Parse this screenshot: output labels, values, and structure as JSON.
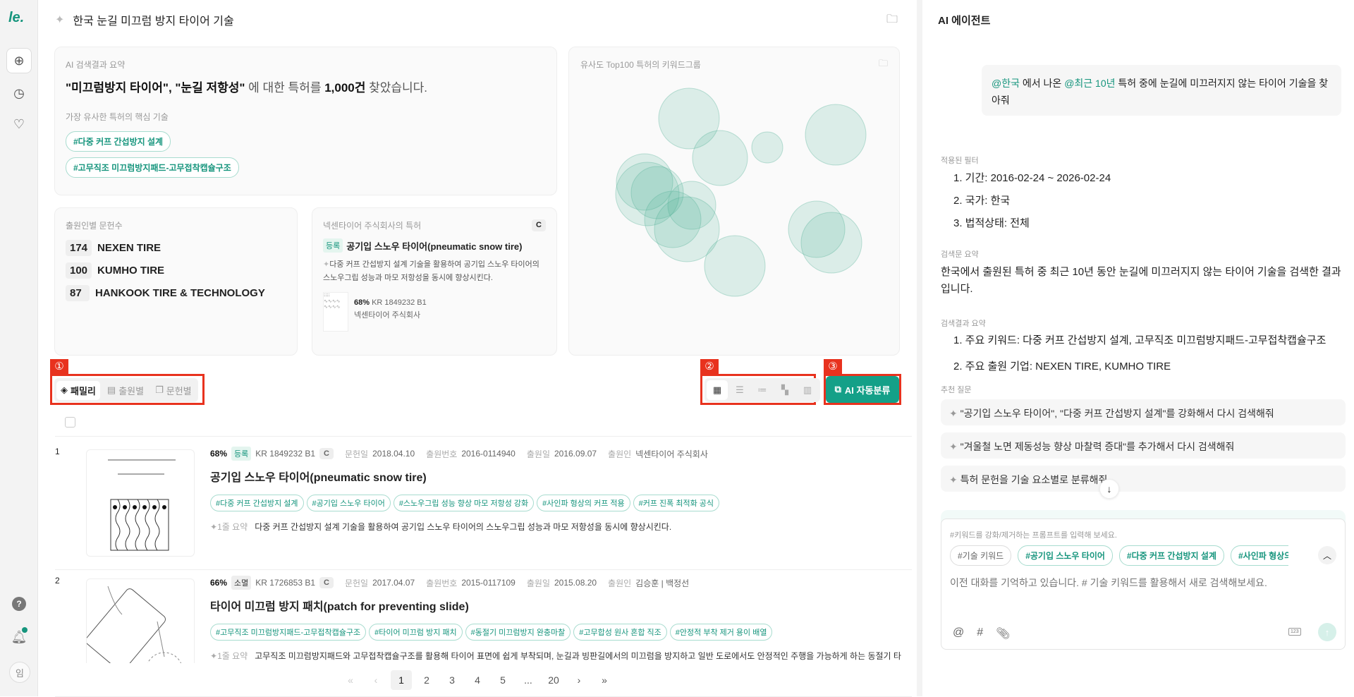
{
  "sidebar": {
    "logo": "le.",
    "avatar": "임",
    "items": [
      "new-search",
      "history",
      "ideas",
      "help",
      "notifications"
    ]
  },
  "header": {
    "title": "한국 눈길 미끄럼 방지 타이어 기술"
  },
  "summary": {
    "label": "AI 검색결과 요약",
    "q1": "\"미끄럼방지 타이어\", \"눈길 저항성\"",
    "mid": " 에 대한 특허를 ",
    "count": "1,000건",
    "end": " 찾았습니다.",
    "core_label": "가장 유사한 특허의 핵심 기술",
    "core_tags": [
      "#다중 커프 간섭방지 설계",
      "#고무직조 미끄럼방지패드-고무접착캡슐구조"
    ]
  },
  "keyword_group": {
    "label": "유사도 Top100 특허의 키워드그룹"
  },
  "applicants": {
    "label": "출원인별 문헌수",
    "items": [
      {
        "count": "174",
        "name": "NEXEN TIRE"
      },
      {
        "count": "100",
        "name": "KUMHO TIRE"
      },
      {
        "count": "87",
        "name": "HANKOOK TIRE & TECHNOLOGY"
      }
    ]
  },
  "featured": {
    "label": "넥센타이어 주식회사의 특허",
    "grade": "C",
    "status": "등록",
    "title": "공기입 스노우 타이어(pneumatic snow tire)",
    "desc": "다중 커프 간섭방지 설계 기술을 활용하여 공기입 스노우 타이어의 스노우그립 성능과 마모 저항성을 동시에 향상시킨다.",
    "score": "68%",
    "number": "KR 1849232 B1",
    "owner": "넥센타이어 주식회사"
  },
  "toolbar": {
    "tabs": [
      "패밀리",
      "출원별",
      "문헌별"
    ],
    "ai_button": "AI 자동분류",
    "markers": [
      "①",
      "②",
      "③"
    ]
  },
  "results": [
    {
      "rank": "1",
      "score": "68%",
      "status": "등록",
      "number": "KR 1849232 B1",
      "grade": "C",
      "pub_label": "문헌일",
      "pub": "2018.04.10",
      "appno_label": "출원번호",
      "appno": "2016-0114940",
      "appdate_label": "출원일",
      "appdate": "2016.09.07",
      "applicant_label": "출원인",
      "applicant": "넥센타이어 주식회사",
      "title": "공기입 스노우 타이어(pneumatic snow tire)",
      "tags": [
        "#다중 커프 간섭방지 설계",
        "#공기입 스노우 타이어",
        "#스노우그립 성능 향상 마모 저항성 강화",
        "#사인파 형상의 커프 적용",
        "#커프 진폭 최적화 공식"
      ],
      "summary_label": "1줄 요약",
      "summary": "다중 커프 간섭방지 설계 기술을 활용하여 공기입 스노우 타이어의 스노우그립 성능과 마모 저항성을 동시에 향상시킨다."
    },
    {
      "rank": "2",
      "score": "66%",
      "status": "소멸",
      "number": "KR 1726853 B1",
      "grade": "C",
      "pub_label": "문헌일",
      "pub": "2017.04.07",
      "appno_label": "출원번호",
      "appno": "2015-0117109",
      "appdate_label": "출원일",
      "appdate": "2015.08.20",
      "applicant_label": "출원인",
      "applicant": "김승훈 | 백정선",
      "title": "타이어 미끄럼 방지 패치(patch for preventing slide)",
      "tags": [
        "#고무직조 미끄럼방지패드-고무접착캡슐구조",
        "#타이어 미끄럼 방지 패치",
        "#동절기 미끄럼방지 완충마찰",
        "#고무합성 원사 혼합 직조",
        "#안정적 부착 제거 용이 배열"
      ],
      "summary_label": "1줄 요약",
      "summary": "고무직조 미끄럼방지패드와 고무접착캡슐구조를 활용해 타이어 표면에 쉽게 부착되며, 눈길과 빙판길에서의 미끄럼을 방지하고 일반 도로에서도 안정적인 주행을 가능하게 하는 동절기 타이"
    }
  ],
  "pagination": {
    "pages": [
      "1",
      "2",
      "3",
      "4",
      "5",
      "...",
      "20"
    ],
    "current": "1",
    "first": "«",
    "prev": "‹",
    "next": "›",
    "last": "»"
  },
  "agent": {
    "title": "AI 에이전트",
    "user_msg": {
      "m1": "@한국",
      "t1": " 에서 나온 ",
      "m2": "@최근 10년",
      "t2": " 특허 중에 눈길에 미끄러지지 않는 타이어 기술을 찾아줘"
    },
    "filters_label": "적용된 필터",
    "filters": [
      "1. 기간: 2016-02-24 ~ 2026-02-24",
      "2. 국가: 한국",
      "3. 법적상태: 전체"
    ],
    "query_label": "검색문 요약",
    "query": "한국에서 출원된 특허 중 최근 10년 동안 눈길에 미끄러지지 않는 타이어 기술을 검색한 결과입니다.",
    "result_label": "검색결과 요약",
    "results": [
      "1. 주요 키워드: 다중 커프 간섭방지 설계, 고무직조 미끄럼방지패드-고무접착캡슐구조",
      "2. 주요 출원 기업: NEXEN TIRE, KUMHO TIRE"
    ],
    "suggest_label": "추천 질문",
    "suggestions": [
      "\"공기입 스노우 타이어\", \"다중 커프 간섭방지 설계\"를 강화해서 다시 검색해줘",
      "\"겨울철 노면 제동성능 향상 마찰력 증대\"를 추가해서 다시 검색해줘",
      "특허 문헌을 기술 요소별로 분류해줘"
    ],
    "input_hint": "#키워드를 강화/제거하는 프롬프트를 입력해 보세요.",
    "input_tags": [
      "#기술 키워드",
      "#공기입 스노우 타이어",
      "#다중 커프 간섭방지 설계",
      "#사인파 형상의 커프 적용"
    ],
    "placeholder": "이전 대화를 기억하고 있습니다. # 기술 키워드를 활용해서 새로 검색해보세요."
  },
  "colors": {
    "accent": "#16957d",
    "button": "#14a088",
    "marker": "#e8321e"
  }
}
